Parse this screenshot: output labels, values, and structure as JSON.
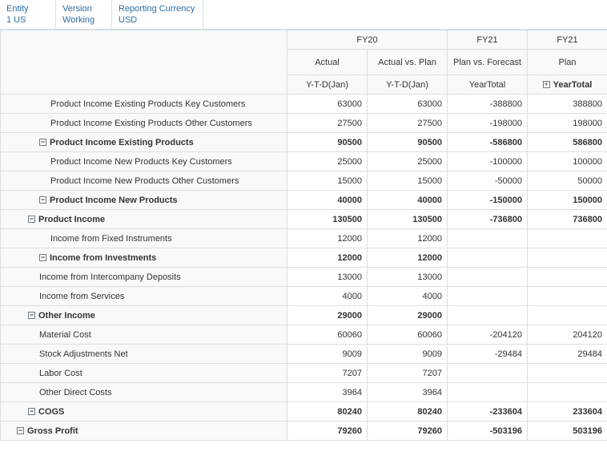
{
  "pov": [
    {
      "label": "Entity",
      "value": "1 US"
    },
    {
      "label": "Version",
      "value": "Working"
    },
    {
      "label": "Reporting Currency",
      "value": "USD"
    }
  ],
  "colGroups": {
    "g1": "FY20",
    "g2": "FY21",
    "g3": "FY21"
  },
  "scenarios": {
    "s1": "Actual",
    "s2": "Actual vs. Plan",
    "s3": "Plan vs. Forecast",
    "s4": "Plan"
  },
  "periods": {
    "p1": "Y-T-D(Jan)",
    "p2": "Y-T-D(Jan)",
    "p3": "YearTotal",
    "p4": "YearTotal"
  },
  "toggle": {
    "collapse": "−",
    "expand": "+"
  },
  "rows": [
    {
      "indent": 62,
      "label": "Product Income Existing Products Key Customers",
      "bold": false,
      "toggle": null,
      "v": [
        "63000",
        "63000",
        "-388800",
        "388800"
      ]
    },
    {
      "indent": 62,
      "label": "Product Income Existing Products Other Customers",
      "bold": false,
      "toggle": null,
      "v": [
        "27500",
        "27500",
        "-198000",
        "198000"
      ]
    },
    {
      "indent": 48,
      "label": "Product Income Existing Products",
      "bold": true,
      "toggle": "collapse",
      "v": [
        "90500",
        "90500",
        "-586800",
        "586800"
      ]
    },
    {
      "indent": 62,
      "label": "Product Income New Products Key Customers",
      "bold": false,
      "toggle": null,
      "v": [
        "25000",
        "25000",
        "-100000",
        "100000"
      ]
    },
    {
      "indent": 62,
      "label": "Product Income New Products Other Customers",
      "bold": false,
      "toggle": null,
      "v": [
        "15000",
        "15000",
        "-50000",
        "50000"
      ]
    },
    {
      "indent": 48,
      "label": "Product Income New Products",
      "bold": true,
      "toggle": "collapse",
      "v": [
        "40000",
        "40000",
        "-150000",
        "150000"
      ]
    },
    {
      "indent": 34,
      "label": "Product Income",
      "bold": true,
      "toggle": "collapse",
      "v": [
        "130500",
        "130500",
        "-736800",
        "736800"
      ]
    },
    {
      "indent": 62,
      "label": "Income from Fixed Instruments",
      "bold": false,
      "toggle": null,
      "v": [
        "12000",
        "12000",
        "",
        ""
      ]
    },
    {
      "indent": 48,
      "label": "Income from Investments",
      "bold": true,
      "toggle": "collapse",
      "v": [
        "12000",
        "12000",
        "",
        ""
      ]
    },
    {
      "indent": 48,
      "label": "Income from Intercompany Deposits",
      "bold": false,
      "toggle": null,
      "v": [
        "13000",
        "13000",
        "",
        ""
      ]
    },
    {
      "indent": 48,
      "label": "Income from Services",
      "bold": false,
      "toggle": null,
      "v": [
        "4000",
        "4000",
        "",
        ""
      ]
    },
    {
      "indent": 34,
      "label": "Other Income",
      "bold": true,
      "toggle": "collapse",
      "v": [
        "29000",
        "29000",
        "",
        ""
      ]
    },
    {
      "indent": 48,
      "label": "Material Cost",
      "bold": false,
      "toggle": null,
      "v": [
        "60060",
        "60060",
        "-204120",
        "204120"
      ]
    },
    {
      "indent": 48,
      "label": "Stock Adjustments Net",
      "bold": false,
      "toggle": null,
      "v": [
        "9009",
        "9009",
        "-29484",
        "29484"
      ]
    },
    {
      "indent": 48,
      "label": "Labor Cost",
      "bold": false,
      "toggle": null,
      "v": [
        "7207",
        "7207",
        "",
        ""
      ]
    },
    {
      "indent": 48,
      "label": "Other Direct Costs",
      "bold": false,
      "toggle": null,
      "v": [
        "3964",
        "3964",
        "",
        ""
      ]
    },
    {
      "indent": 34,
      "label": "COGS",
      "bold": true,
      "toggle": "collapse",
      "v": [
        "80240",
        "80240",
        "-233604",
        "233604"
      ]
    },
    {
      "indent": 20,
      "label": "Gross Profit",
      "bold": true,
      "toggle": "collapse",
      "v": [
        "79260",
        "79260",
        "-503196",
        "503196"
      ]
    }
  ]
}
